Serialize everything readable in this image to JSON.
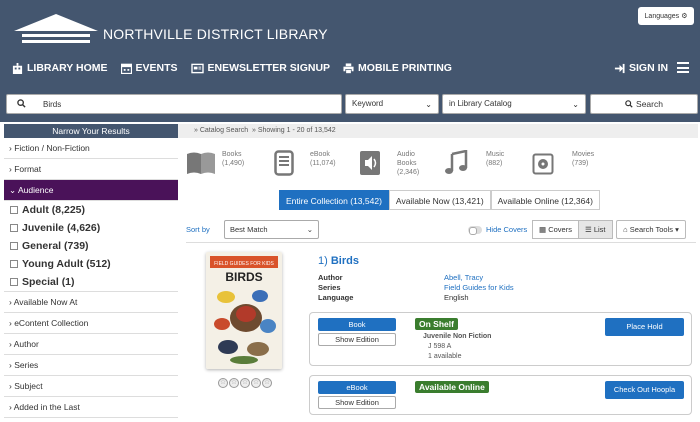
{
  "header": {
    "library_name": "NORTHVILLE DISTRICT LIBRARY",
    "languages_label": "Languages",
    "nav": [
      {
        "label": "LIBRARY HOME",
        "icon": "building-icon"
      },
      {
        "label": "EVENTS",
        "icon": "calendar-icon"
      },
      {
        "label": "ENEWSLETTER SIGNUP",
        "icon": "newspaper-icon"
      },
      {
        "label": "MOBILE PRINTING",
        "icon": "printer-icon"
      }
    ],
    "sign_in_label": "SIGN IN"
  },
  "search": {
    "query": "Birds",
    "search_by": "Keyword",
    "scope": "in Library Catalog",
    "button_label": "Search"
  },
  "sidebar": {
    "title": "Narrow Your Results",
    "facets_top": [
      "Fiction / Non-Fiction",
      "Format"
    ],
    "open_facet": "Audience",
    "audience_options": [
      "Adult (8,225)",
      "Juvenile (4,626)",
      "General (739)",
      "Young Adult (512)",
      "Special (1)"
    ],
    "facets_bottom": [
      "Available Now At",
      "eContent Collection",
      "Author",
      "Series",
      "Subject",
      "Added in the Last"
    ]
  },
  "breadcrumb": {
    "link": "Catalog Search",
    "showing": "Showing 1 - 20 of 13,542"
  },
  "formats": [
    {
      "name": "Books",
      "count": "(1,490)"
    },
    {
      "name": "eBook",
      "count": "(11,074)"
    },
    {
      "name_line1": "Audio",
      "name_line2": "Books",
      "count": "(2,346)"
    },
    {
      "name": "Music",
      "count": "(882)"
    },
    {
      "name": "Movies",
      "count": "(739)"
    }
  ],
  "tabs": [
    "Entire Collection (13,542)",
    "Available Now (13,421)",
    "Available Online (12,364)"
  ],
  "sort": {
    "label": "Sort by",
    "value": "Best Match",
    "hide_covers": "Hide Covers",
    "covers": "Covers",
    "list": "List",
    "search_tools": "Search Tools"
  },
  "result": {
    "number": "1)",
    "title": "Birds",
    "cover_series": "FIELD GUIDES FOR KIDS",
    "cover_title": "BIRDS",
    "fields": [
      {
        "key": "Author",
        "value": "Abell, Tracy",
        "link": true
      },
      {
        "key": "Series",
        "value": "Field Guides for Kids",
        "link": true
      },
      {
        "key": "Language",
        "value": "English",
        "link": false
      }
    ],
    "rating": 0,
    "formats": [
      {
        "format": "Book",
        "edition": "Show Edition",
        "status": "On Shelf",
        "collection": "Juvenile Non Fiction",
        "call_number": "J 598 A",
        "available": "1 available",
        "action": "Place Hold"
      },
      {
        "format": "eBook",
        "edition": "Show Edition",
        "status": "Available Online",
        "action": "Check Out Hoopla"
      }
    ]
  },
  "colors": {
    "header": "#44566f",
    "primary": "#1f70c1",
    "facet_open": "#4a1259",
    "status_green": "#3a7d2e"
  }
}
